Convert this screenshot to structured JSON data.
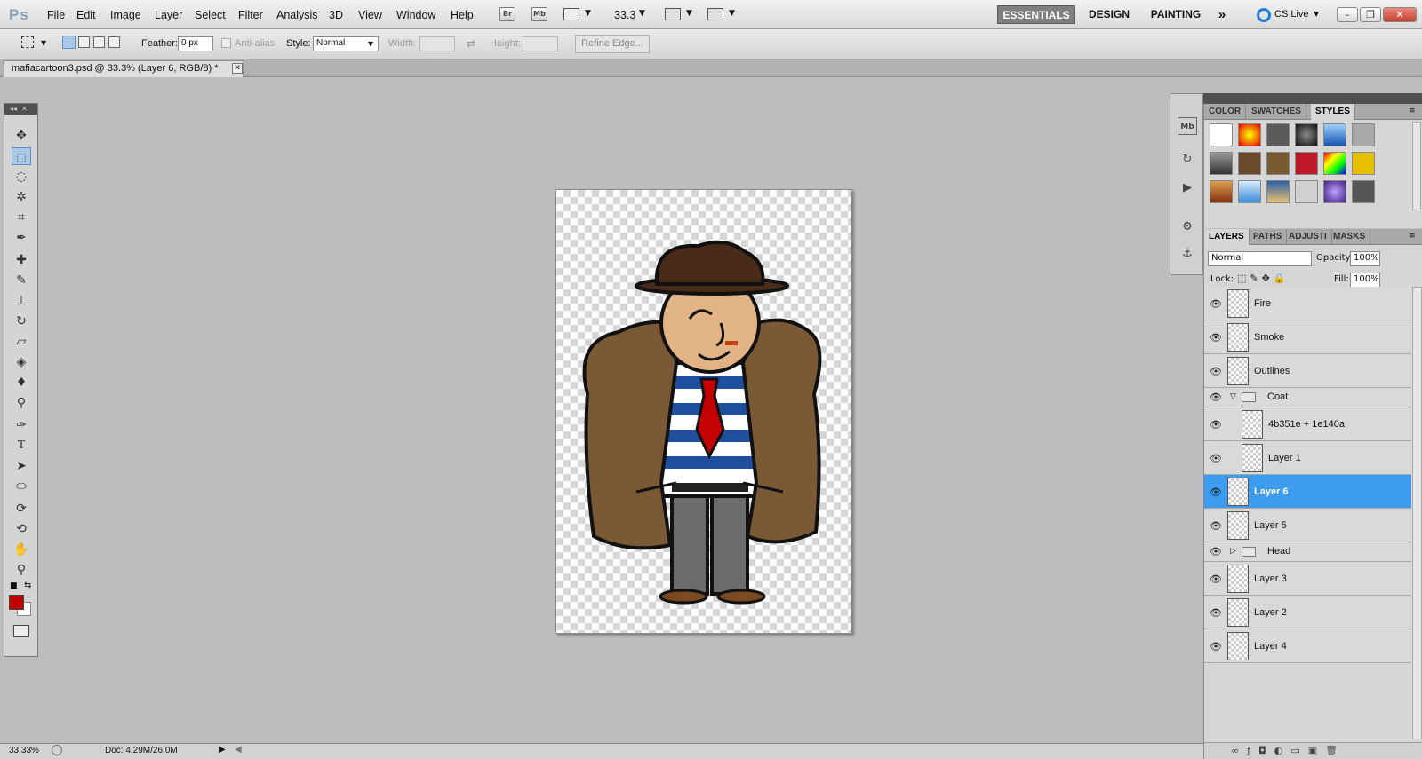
{
  "menubar": {
    "logo": "Ps",
    "menus": [
      "File",
      "Edit",
      "Image",
      "Layer",
      "Select",
      "Filter",
      "Analysis",
      "3D",
      "View",
      "Window",
      "Help"
    ],
    "br": "Br",
    "mb": "Mb",
    "zoom": "33.3",
    "workspaces": [
      "ESSENTIALS",
      "DESIGN",
      "PAINTING"
    ],
    "more": "»",
    "cslive": "CS Live"
  },
  "options": {
    "feather_label": "Feather:",
    "feather_value": "0 px",
    "antialias": "Anti-alias",
    "style_label": "Style:",
    "style_value": "Normal",
    "width_label": "Width:",
    "height_label": "Height:",
    "refine": "Refine Edge..."
  },
  "document": {
    "tab": "mafiacartoon3.psd @ 33.3% (Layer 6, RGB/8) *"
  },
  "status": {
    "zoom": "33.33%",
    "doc": "Doc: 4.29M/26.0M"
  },
  "styles_panel": {
    "tabs": [
      "COLOR",
      "SWATCHES",
      "STYLES"
    ],
    "active": "STYLES"
  },
  "layers_panel": {
    "tabs": [
      "LAYERS",
      "PATHS",
      "ADJUSTI",
      "MASKS"
    ],
    "blend": "Normal",
    "opacity_label": "Opacity:",
    "opacity": "100%",
    "lock_label": "Lock:",
    "fill_label": "Fill:",
    "fill": "100%",
    "layers": [
      {
        "name": "Fire",
        "type": "layer"
      },
      {
        "name": "Smoke",
        "type": "layer"
      },
      {
        "name": "Outlines",
        "type": "layer"
      },
      {
        "name": "Coat",
        "type": "group-open"
      },
      {
        "name": "4b351e + 1e140a",
        "type": "child"
      },
      {
        "name": "Layer 1",
        "type": "child"
      },
      {
        "name": "Layer 6",
        "type": "layer",
        "selected": true
      },
      {
        "name": "Layer 5",
        "type": "layer"
      },
      {
        "name": "Head",
        "type": "group-closed"
      },
      {
        "name": "Layer 3",
        "type": "layer"
      },
      {
        "name": "Layer 2",
        "type": "layer"
      },
      {
        "name": "Layer 4",
        "type": "layer"
      }
    ]
  },
  "colors": {
    "foreground": "#c00000",
    "background": "#ffffff",
    "selection": "#3d9bf0"
  }
}
